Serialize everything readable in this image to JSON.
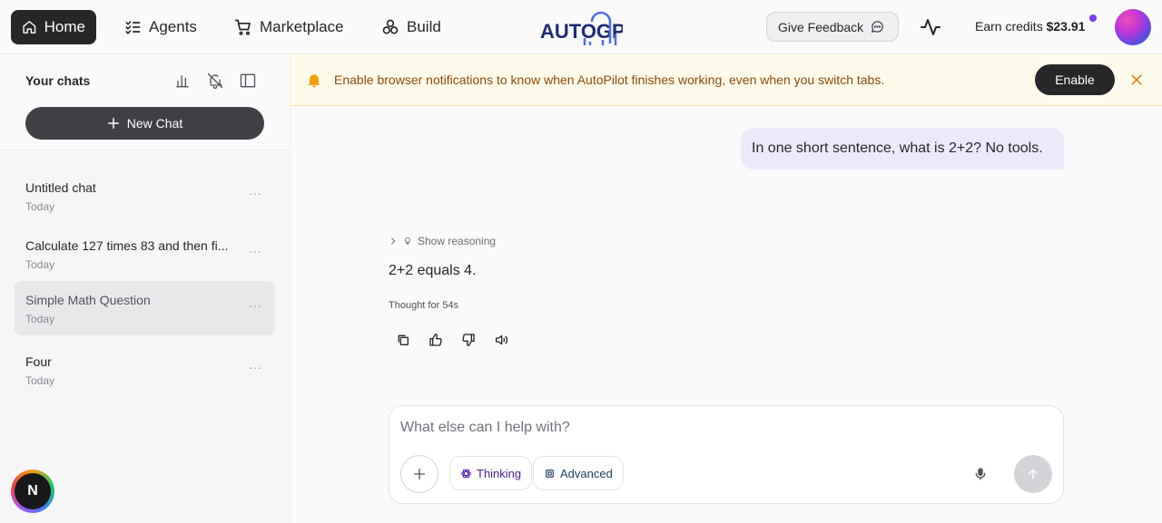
{
  "nav": {
    "home": "Home",
    "agents": "Agents",
    "marketplace": "Marketplace",
    "build": "Build",
    "logo_text": "AUTOGPT",
    "feedback": "Give Feedback",
    "credits_label": "Earn credits",
    "credits_value": "$23.91"
  },
  "sidebar": {
    "title": "Your chats",
    "new_chat": "New Chat",
    "chats": [
      {
        "title": "Untitled chat",
        "date": "Today",
        "active": false
      },
      {
        "title": "Calculate 127 times 83 and then fi...",
        "date": "Today",
        "active": false
      },
      {
        "title": "Simple Math Question",
        "date": "Today",
        "active": true
      },
      {
        "title": "Four",
        "date": "Today",
        "active": false
      }
    ],
    "more": "...",
    "badge_initial": "N"
  },
  "banner": {
    "text": "Enable browser notifications to know when AutoPilot finishes working, even when you switch tabs.",
    "enable": "Enable"
  },
  "conversation": {
    "user_message": "In one short sentence, what is 2+2? No tools.",
    "show_reasoning": "Show reasoning",
    "answer": "2+2 equals 4.",
    "thought": "Thought for 54s"
  },
  "composer": {
    "placeholder": "What else can I help with?",
    "thinking": "Thinking",
    "advanced": "Advanced"
  },
  "colors": {
    "primary_dark": "#27272a",
    "user_bubble": "#ede9fb",
    "banner_bg": "#fffbea",
    "banner_text": "#8a4b08",
    "credit_dot": "#7c3aed"
  }
}
